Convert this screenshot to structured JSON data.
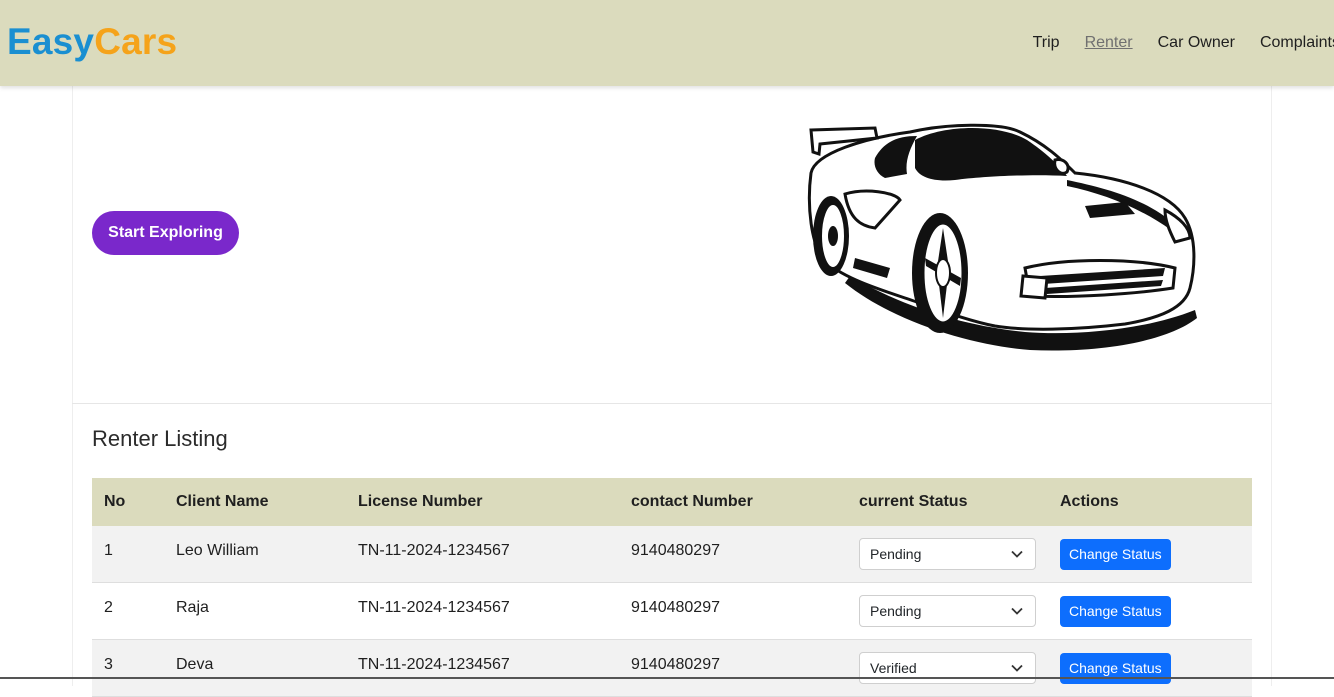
{
  "brand": {
    "part1": "Easy",
    "part2": "Cars",
    "color1": "#1a8fd1",
    "color2": "#f5a31a"
  },
  "nav": {
    "items": [
      {
        "label": "Trip",
        "active": false
      },
      {
        "label": "Renter",
        "active": true
      },
      {
        "label": "Car Owner",
        "active": false
      },
      {
        "label": "Complaints",
        "active": false
      }
    ]
  },
  "hero": {
    "cta_label": "Start Exploring",
    "cta_color": "#7a28cb",
    "image_icon": "sports-car-illustration"
  },
  "listing": {
    "title": "Renter Listing",
    "columns": [
      "No",
      "Client Name",
      "License Number",
      "contact Number",
      "current Status",
      "Actions"
    ],
    "status_options": [
      "Pending",
      "Verified"
    ],
    "action_label": "Change Status",
    "rows": [
      {
        "no": "1",
        "client_name": "Leo William",
        "license": "TN-11-2024-1234567",
        "contact": "9140480297",
        "status": "Pending"
      },
      {
        "no": "2",
        "client_name": "Raja",
        "license": "TN-11-2024-1234567",
        "contact": "9140480297",
        "status": "Pending"
      },
      {
        "no": "3",
        "client_name": "Deva",
        "license": "TN-11-2024-1234567",
        "contact": "9140480297",
        "status": "Verified"
      }
    ]
  },
  "colors": {
    "header_bg": "#dbdbbd",
    "button_primary": "#0d6efd"
  }
}
